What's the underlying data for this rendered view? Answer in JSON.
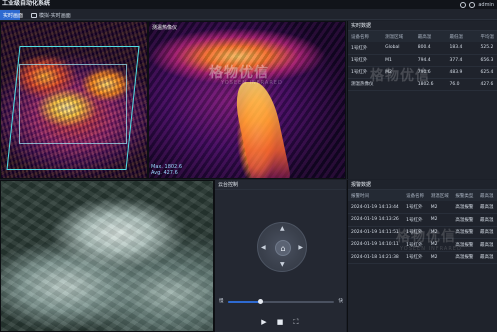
{
  "app": {
    "title": "工业级自动化系统",
    "user_name": "admin"
  },
  "tabs": [
    {
      "label": "实时画面"
    },
    {
      "label": "模拟-实时画面"
    }
  ],
  "panes": {
    "right_label": "测温热像仪",
    "temp_max": "Max. 1802.6",
    "temp_avg": "Avg. 427.6"
  },
  "watermark": {
    "text": "格物优信",
    "sub": "YOSEEN INFRARED"
  },
  "realtime": {
    "header": "实时数据",
    "columns": [
      "设备名称",
      "测温区域",
      "最高温",
      "最低温",
      "平均温"
    ],
    "rows": [
      [
        "1号红外",
        "Global",
        "800.4",
        "183.4",
        "525.2"
      ],
      [
        "1号红外",
        "M1",
        "794.4",
        "377.4",
        "656.3"
      ],
      [
        "1号红外",
        "M2",
        "790.6",
        "483.9",
        "625.4"
      ],
      [
        "测温热像仪",
        "",
        "1802.6",
        "76.0",
        "427.6"
      ]
    ]
  },
  "ptz": {
    "header": "云台控制",
    "slider_min": "慢",
    "slider_max": "快",
    "speed_fraction": 0.3
  },
  "alarm": {
    "header": "报警数据",
    "columns": [
      "报警时间",
      "设备名称",
      "测温区域",
      "报警类型",
      "最高温"
    ],
    "rows": [
      [
        "2024-01-19 14:13:44",
        "1号红外",
        "M2",
        "高温报警",
        "最高温"
      ],
      [
        "2024-01-19 14:13:26",
        "1号红外",
        "M2",
        "高温报警",
        "最高温"
      ],
      [
        "2024-01-19 14:11:51",
        "1号红外",
        "M2",
        "高温报警",
        "最高温"
      ],
      [
        "2024-01-19 14:10:11",
        "1号红外",
        "M2",
        "高温报警",
        "最高温"
      ],
      [
        "2024-01-18 14:21:38",
        "1号红外",
        "M2",
        "高温报警",
        "最高温"
      ]
    ]
  },
  "colors": {
    "accent": "#2e6ad1",
    "background": "#1c2029",
    "roi": "#4fe0e6"
  }
}
